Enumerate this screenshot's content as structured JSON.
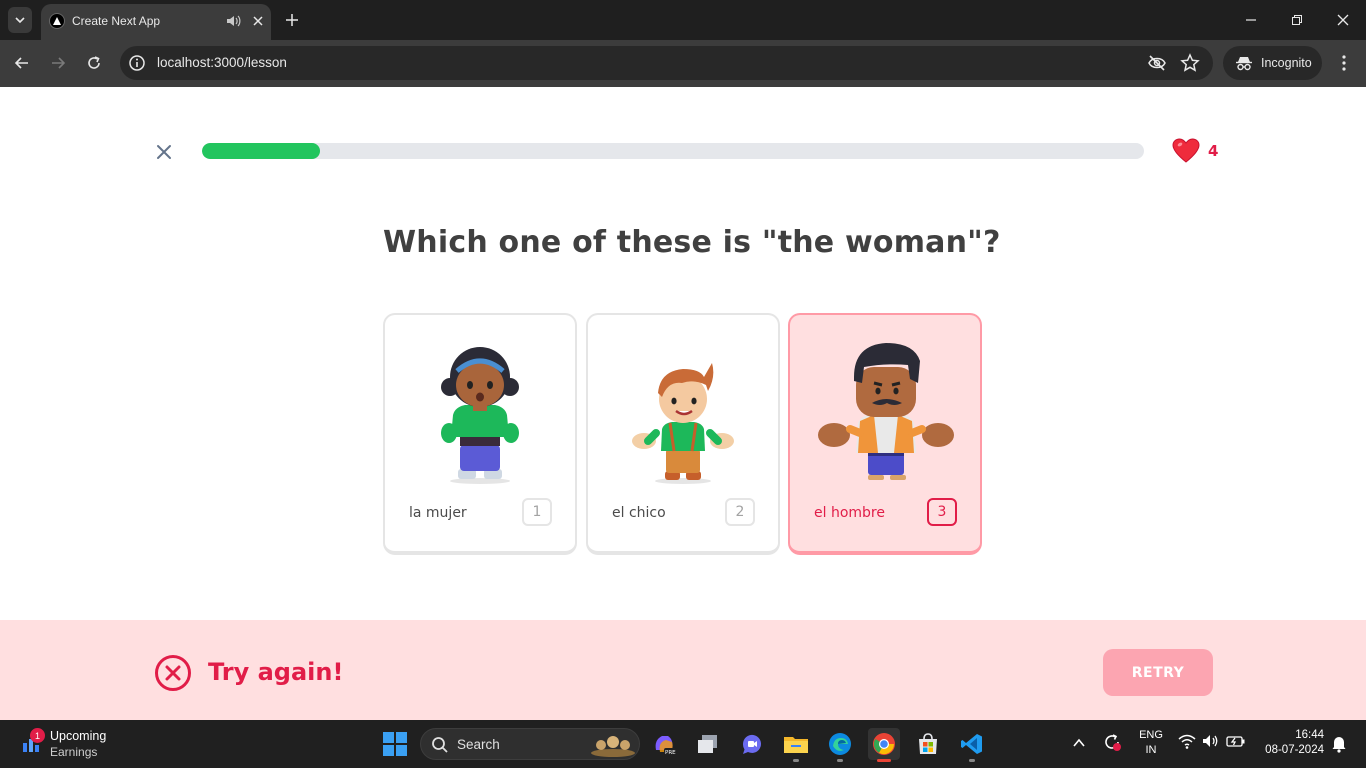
{
  "browser": {
    "tab_title": "Create Next App",
    "url": "localhost:3000/lesson",
    "incognito_label": "Incognito"
  },
  "lesson": {
    "progress_fraction": 0.125,
    "hearts": "4",
    "question": "Which one of these is \"the woman\"?",
    "options": [
      {
        "label": "la mujer",
        "shortcut": "1",
        "character": "woman",
        "state": "default"
      },
      {
        "label": "el chico",
        "shortcut": "2",
        "character": "boy",
        "state": "default"
      },
      {
        "label": "el hombre",
        "shortcut": "3",
        "character": "man",
        "state": "selected-wrong"
      }
    ],
    "feedback": "Try again!",
    "retry_label": "RETRY"
  },
  "colors": {
    "progress": "#22c55e",
    "error": "#e11d48",
    "error_bg": "#ffdfe0",
    "retry_bg": "#fca5b1"
  },
  "taskbar": {
    "widget_title": "Upcoming",
    "widget_subtitle": "Earnings",
    "widget_badge": "1",
    "search_label": "Search",
    "lang_line1": "ENG",
    "lang_line2": "IN",
    "time": "16:44",
    "date": "08-07-2024"
  }
}
